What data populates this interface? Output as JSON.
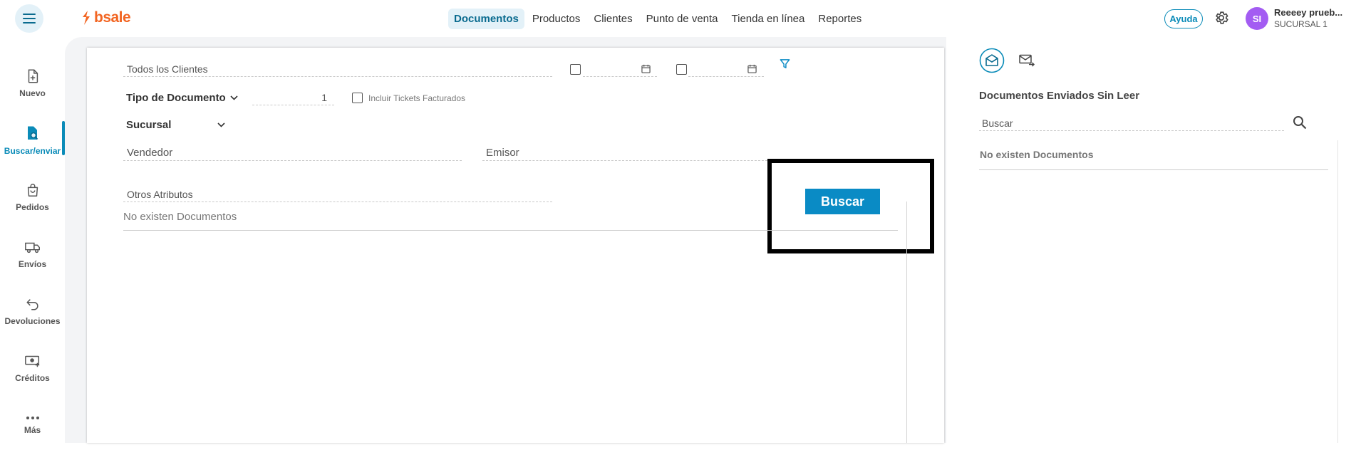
{
  "brand": {
    "name": "bsale",
    "color": "#f26522"
  },
  "topnav": {
    "items": [
      {
        "label": "Documentos",
        "active": true
      },
      {
        "label": "Productos"
      },
      {
        "label": "Clientes"
      },
      {
        "label": "Punto de venta"
      },
      {
        "label": "Tienda en línea"
      },
      {
        "label": "Reportes"
      }
    ]
  },
  "header": {
    "help_label": "Ayuda",
    "user_initials": "SI",
    "user_name": "Reeeey prueb...",
    "branch": "SUCURSAL 1"
  },
  "sidebar": {
    "items": [
      {
        "label": "Nuevo",
        "icon": "file-plus-icon"
      },
      {
        "label": "Buscar/enviar",
        "icon": "file-search-icon",
        "active": true
      },
      {
        "label": "Pedidos",
        "icon": "bag-icon"
      },
      {
        "label": "Envíos",
        "icon": "truck-icon"
      },
      {
        "label": "Devoluciones",
        "icon": "return-arrow-icon"
      },
      {
        "label": "Créditos",
        "icon": "cash-icon"
      },
      {
        "label": "Más",
        "icon": "more-dots-icon"
      }
    ]
  },
  "filters": {
    "clients_placeholder": "Todos los Clientes",
    "doc_type_label": "Tipo de Documento",
    "doc_number": "1",
    "include_tickets_label": "Incluir Tickets Facturados",
    "branch_label": "Sucursal",
    "seller_placeholder": "Vendedor",
    "issuer_placeholder": "Emisor",
    "other_attrs_placeholder": "Otros Atributos",
    "search_button": "Buscar"
  },
  "results": {
    "empty_message": "No existen Documentos"
  },
  "right_panel": {
    "title": "Documentos Enviados Sin Leer",
    "search_placeholder": "Buscar",
    "empty_message": "No existen Documentos"
  },
  "colors": {
    "accent": "#0a8bc5",
    "active_bg": "#e3f1f8",
    "avatar": "#a35cf2"
  }
}
